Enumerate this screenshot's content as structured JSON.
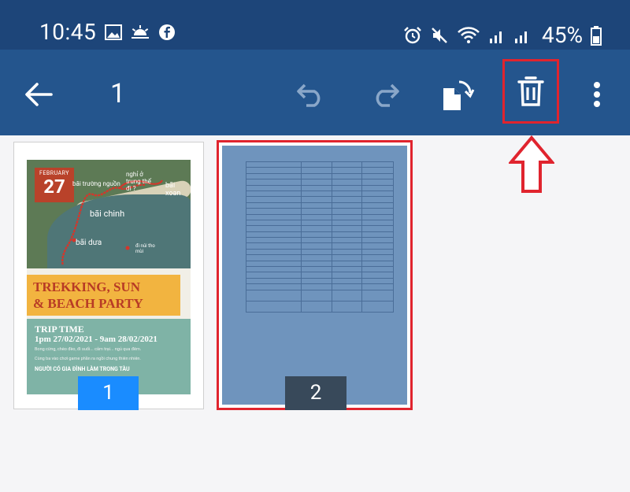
{
  "status_bar": {
    "time": "10:45",
    "battery_percent": "45%"
  },
  "toolbar": {
    "page_number": "1"
  },
  "pages": [
    {
      "label": "1",
      "poster": {
        "date_month": "FEBRUARY",
        "date_day": "27",
        "map_labels": [
          "bãi trường nguồn",
          "nghỉ ở trung thế đi ?",
          "bãi xoan",
          "bãi chinh",
          "bãi dưa",
          "đi núi tho mùi"
        ],
        "title_line1": "TREKKING, SUN",
        "title_line2": "& BEACH PARTY",
        "trip_heading": "TRIP TIME",
        "trip_times": "1pm 27/02/2021 - 9am 28/02/2021",
        "trip_line1": "Bong cừng, chèo đèo, đi suối... cắm trại... ngủ qua đêm.",
        "trip_line2": "Cùng ba vào chơi game phần ra ngồi chung thiên nhiên.",
        "trip_footer": "NGƯỜI CÓ GIA ĐÌNH LÀM TRONG TÀU"
      }
    },
    {
      "label": "2"
    }
  ],
  "colors": {
    "status_bar": "#1d4579",
    "toolbar": "#24558d",
    "highlight": "#e0242e",
    "page1_badge": "#1a8cff",
    "page2_badge": "#38495a"
  }
}
